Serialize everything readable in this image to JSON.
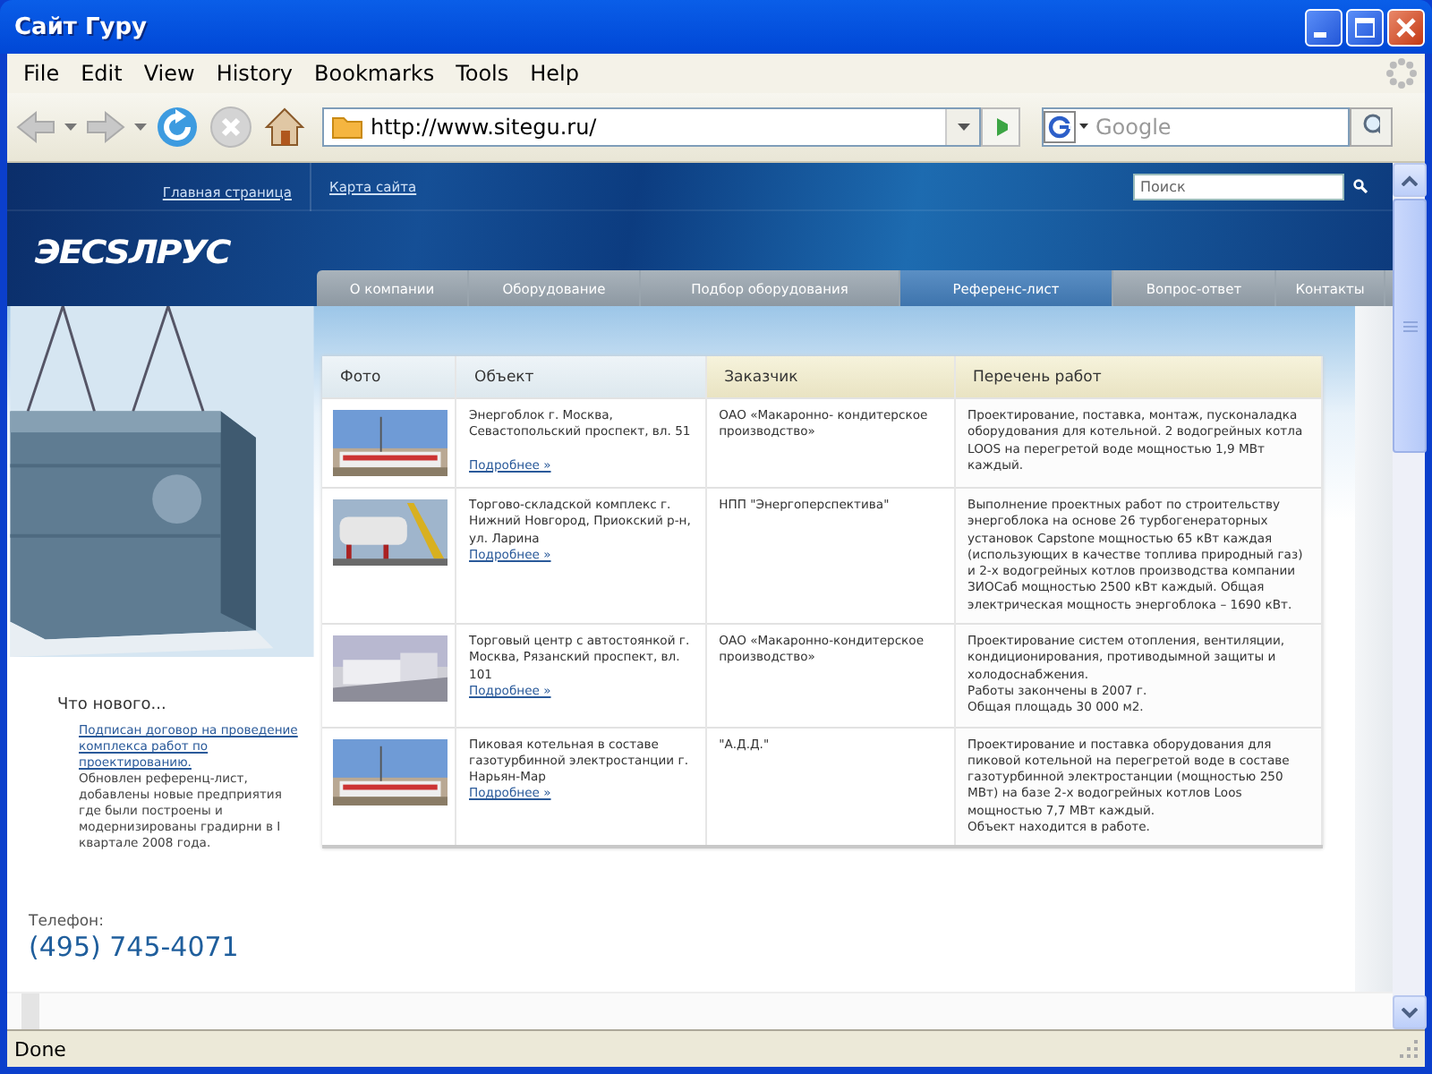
{
  "window": {
    "title": "Сайт Гуру"
  },
  "menu": [
    "File",
    "Edit",
    "View",
    "History",
    "Bookmarks",
    "Tools",
    "Help"
  ],
  "toolbar": {
    "url": "http://www.sitegu.ru/",
    "search_placeholder": "Google"
  },
  "site": {
    "top_links": [
      "Главная страница",
      "Карта сайта"
    ],
    "search_placeholder": "Поиск",
    "logo": "ЭЕСЅЛРУС",
    "nav": [
      {
        "label": "О компании",
        "selected": false
      },
      {
        "label": "Оборудование",
        "selected": false
      },
      {
        "label": "Подбор оборудования",
        "selected": false
      },
      {
        "label": "Референс-лист",
        "selected": true
      },
      {
        "label": "Вопрос-ответ",
        "selected": false
      },
      {
        "label": "Контакты",
        "selected": false
      }
    ],
    "news": {
      "heading": "Что нового...",
      "link": "Подписан договор на проведение комплекса работ по проектированию.",
      "text": "Обновлен референц-лист, добавлены новые предприятия где были построены и модернизированы градирни в I квартале 2008 года."
    },
    "phone": {
      "label": "Телефон:",
      "number": "(495) 745-4071"
    },
    "table": {
      "columns": [
        {
          "label": "Фото",
          "highlighted": false
        },
        {
          "label": "Объект",
          "highlighted": false
        },
        {
          "label": "Заказчик",
          "highlighted": true
        },
        {
          "label": "Перечень работ",
          "highlighted": true
        }
      ],
      "rows": [
        {
          "object": "Энергоблок г. Москва, Севастопольский проспект, вл. 51",
          "link": "Подробнее »",
          "customer": "ОАО «Макаронно- кондитерское производство»",
          "works": "Проектирование, поставка, монтаж, пусконаладка оборудования для котельной. 2 водогрейных котла LOOS на перегретой воде мощностью 1,9 МВт каждый."
        },
        {
          "object": "Торгово-складской комплекс г. Нижний Новгород, Приокский р-н, ул. Ларина",
          "link": "Подробнее »",
          "customer": "НПП \"Энергоперспектива\"",
          "works": "Выполнение проектных работ по строительству энергоблока на основе 26 турбогенераторных установок Capstone мощностью 65 кВт каждая (использующих в качестве топлива природный газ) и 2-х водогрейных котлов производства компании ЗИОСаб мощностью 2500 кВт каждый. Общая электрическая мощность энергоблока – 1690 кВт."
        },
        {
          "object": "Торговый центр с автостоянкой г. Москва, Рязанский проспект, вл. 101",
          "link": "Подробнее »",
          "customer": "ОАО «Макаронно-кондитерское производство»",
          "works": "Проектирование систем отопления, вентиляции, кондиционирования, противодымной защиты и холодоснабжения.\nРаботы закончены в 2007 г.\nОбщая площадь 30 000 м2."
        },
        {
          "object": "Пиковая котельная в составе газотурбинной электростанции г. Нарьян-Мар",
          "link": "Подробнее »",
          "customer": "\"А.Д.Д.\"",
          "works": "Проектирование и поставка оборудования для пиковой котельной на перегретой воде в составе газотурбинной электростанции (мощностью 250 МВт) на базе 2-х водогрейных котлов Loos мощностью 7,7 МВт каждый.\nОбъект находится в работе."
        }
      ]
    }
  },
  "status_bar": "Done"
}
